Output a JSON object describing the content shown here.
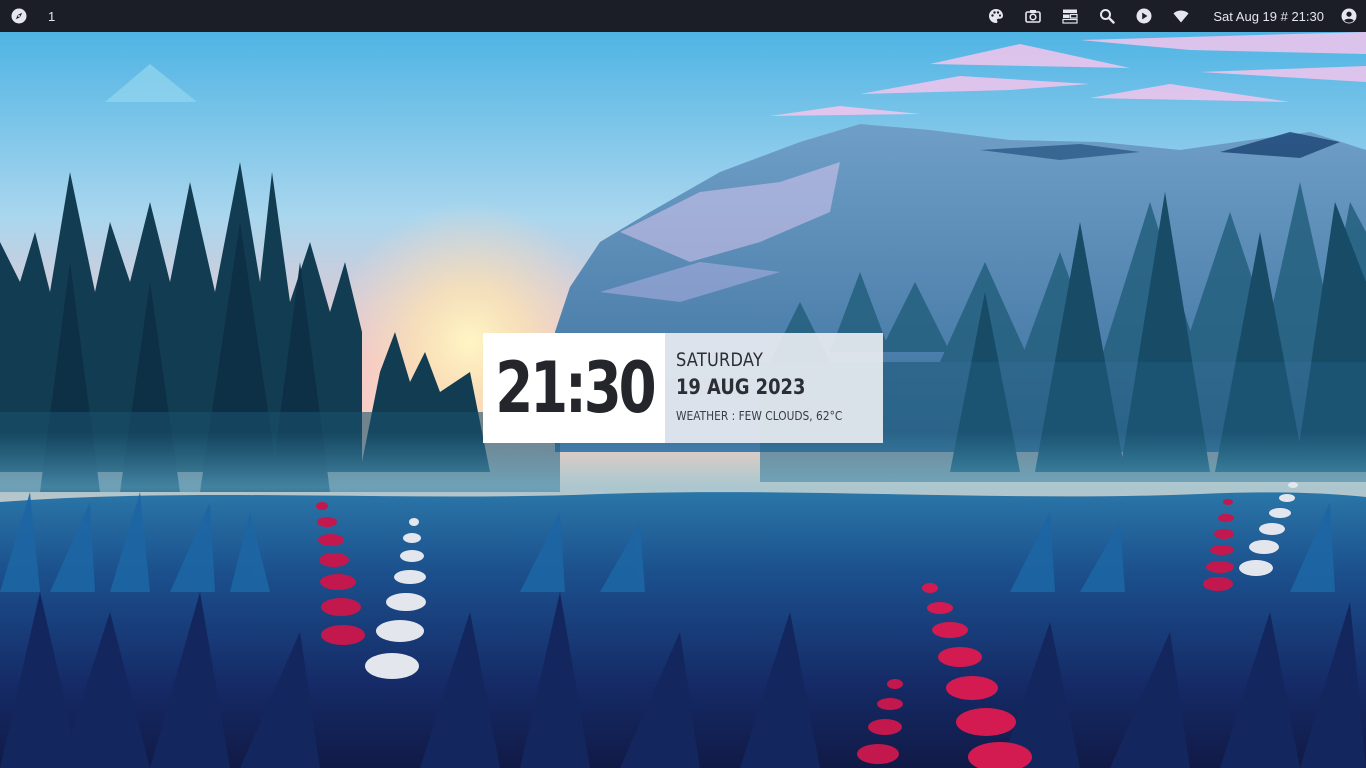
{
  "topbar": {
    "launcher_icon": "compass-icon",
    "workspace": "1",
    "tray_icons": [
      "palette-icon",
      "camera-icon",
      "layout-icon",
      "search-icon",
      "play-icon",
      "wifi-icon"
    ],
    "clock": "Sat Aug 19 # 21:30",
    "user_icon": "user-circle-icon"
  },
  "widget": {
    "time": "21:30",
    "day": "SATURDAY",
    "date": "19 AUG 2023",
    "weather": "WEATHER : FEW CLOUDS, 62°C"
  },
  "colors": {
    "topbar_bg": "#1b1d27",
    "widget_time_bg": "#ffffff",
    "widget_info_bg": "#e8ecf1",
    "text_dark": "#25262b"
  }
}
